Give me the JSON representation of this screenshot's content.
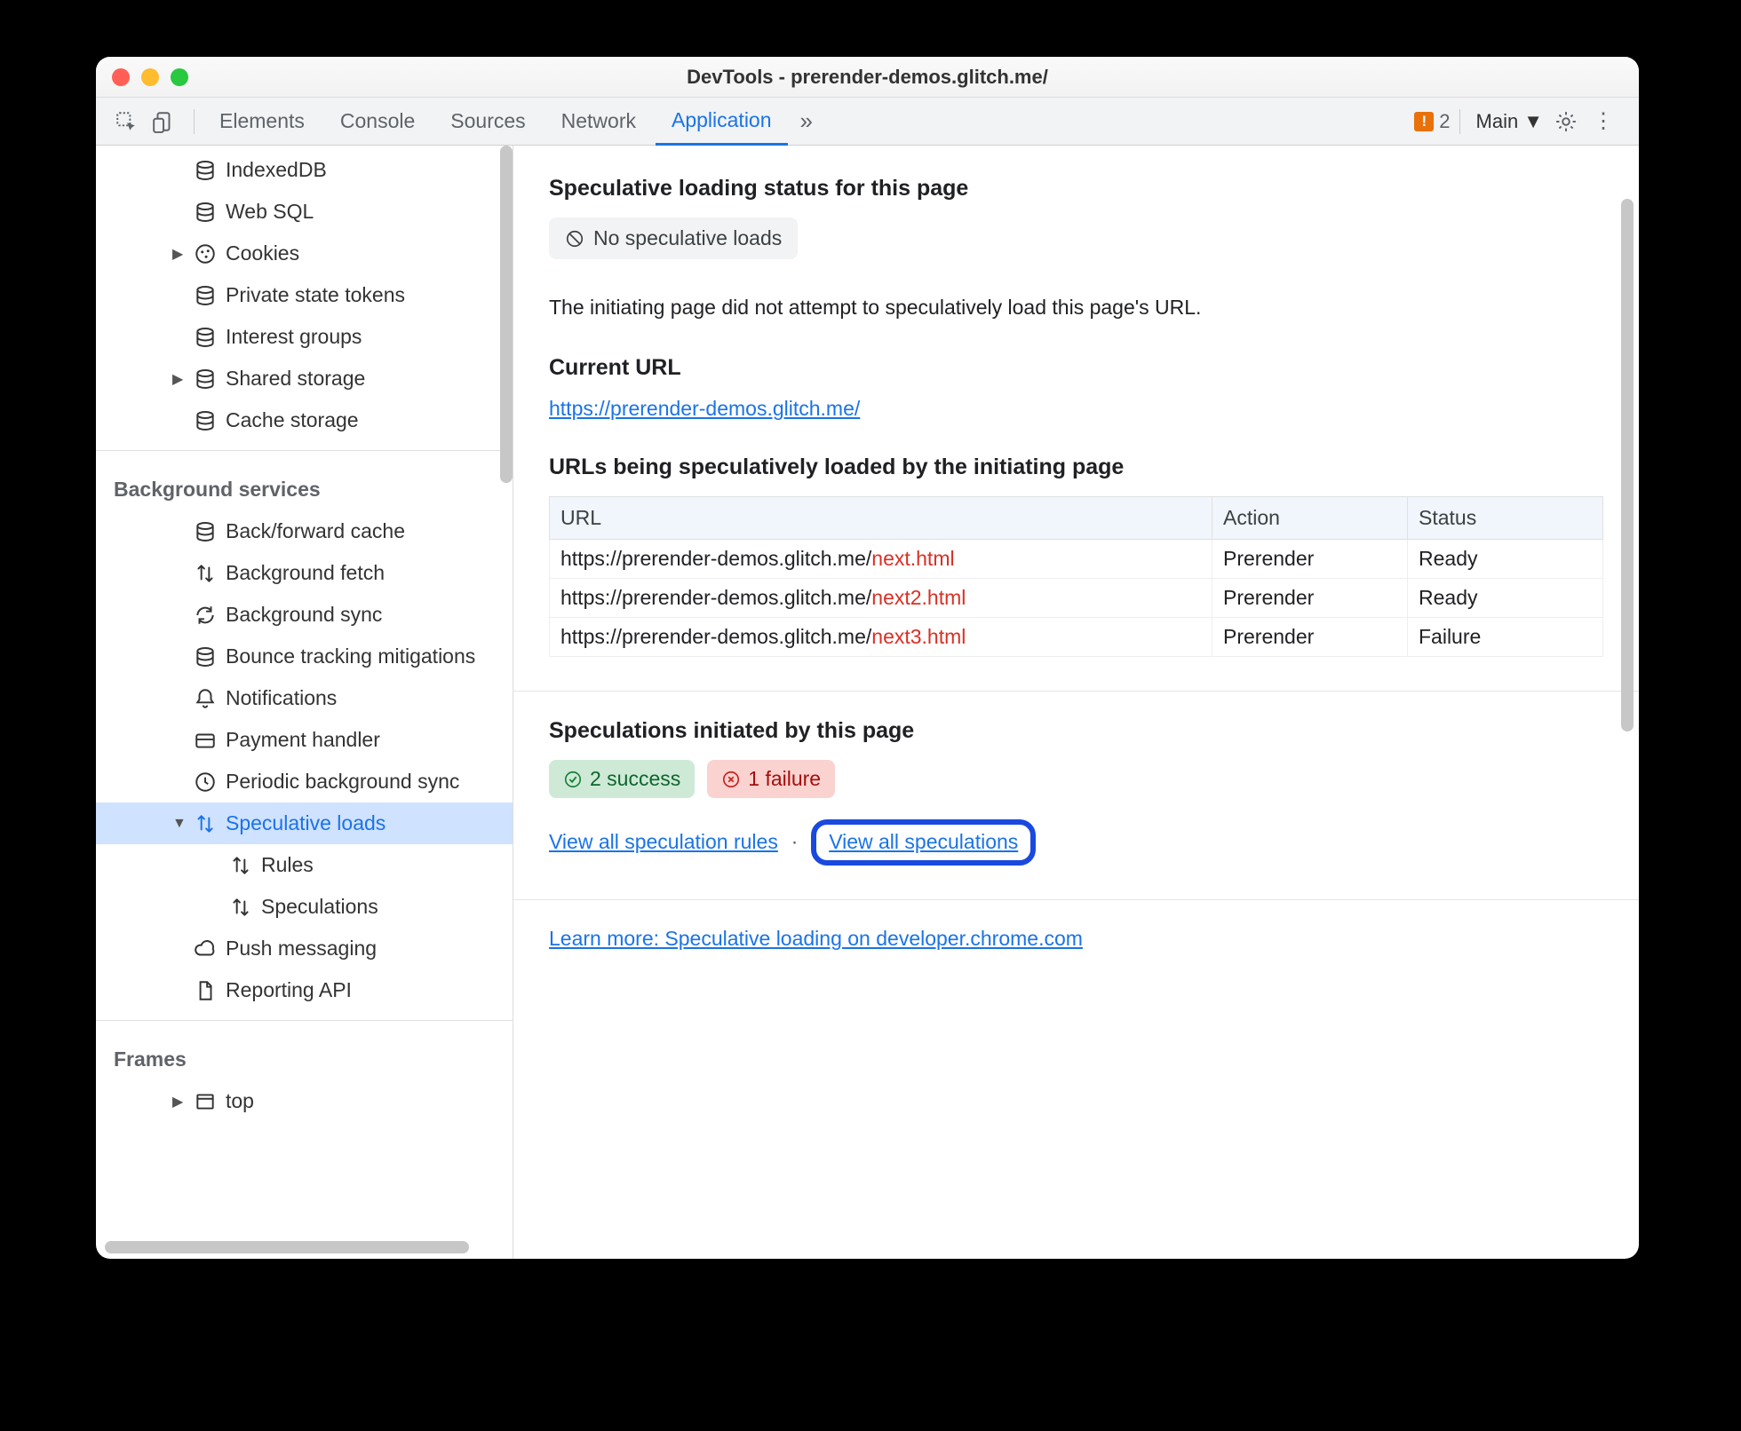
{
  "window": {
    "title": "DevTools - prerender-demos.glitch.me/"
  },
  "toolbar": {
    "tabs": [
      "Elements",
      "Console",
      "Sources",
      "Network",
      "Application"
    ],
    "active_tab": 4,
    "issues_count": "2",
    "main_label": "Main"
  },
  "sidebar": {
    "items_top": [
      {
        "icon": "db",
        "label": "IndexedDB"
      },
      {
        "icon": "db",
        "label": "Web SQL"
      },
      {
        "icon": "cookie",
        "label": "Cookies",
        "caret": true
      },
      {
        "icon": "db",
        "label": "Private state tokens"
      },
      {
        "icon": "db",
        "label": "Interest groups"
      },
      {
        "icon": "db",
        "label": "Shared storage",
        "caret": true
      },
      {
        "icon": "db",
        "label": "Cache storage"
      }
    ],
    "group_bg": "Background services",
    "bg_items": [
      {
        "icon": "db",
        "label": "Back/forward cache"
      },
      {
        "icon": "updown",
        "label": "Background fetch"
      },
      {
        "icon": "sync",
        "label": "Background sync"
      },
      {
        "icon": "db",
        "label": "Bounce tracking mitigations"
      },
      {
        "icon": "bell",
        "label": "Notifications"
      },
      {
        "icon": "card",
        "label": "Payment handler"
      },
      {
        "icon": "clock",
        "label": "Periodic background sync"
      },
      {
        "icon": "updown",
        "label": "Speculative loads",
        "selected": true,
        "caret_down": true
      },
      {
        "icon": "updown",
        "label": "Rules",
        "indent": 2
      },
      {
        "icon": "updown",
        "label": "Speculations",
        "indent": 2
      },
      {
        "icon": "cloud",
        "label": "Push messaging"
      },
      {
        "icon": "file",
        "label": "Reporting API"
      }
    ],
    "group_frames": "Frames",
    "frames_items": [
      {
        "icon": "frame",
        "label": "top",
        "caret": true
      }
    ]
  },
  "content": {
    "h_status": "Speculative loading status for this page",
    "no_loads": "No speculative loads",
    "note": "The initiating page did not attempt to speculatively load this page's URL.",
    "h_current": "Current URL",
    "current_url": "https://prerender-demos.glitch.me/",
    "h_urls": "URLs being speculatively loaded by the initiating page",
    "table": {
      "headers": [
        "URL",
        "Action",
        "Status"
      ],
      "rows": [
        {
          "base": "https://prerender-demos.glitch.me/",
          "path": "next.html",
          "action": "Prerender",
          "status": "Ready"
        },
        {
          "base": "https://prerender-demos.glitch.me/",
          "path": "next2.html",
          "action": "Prerender",
          "status": "Ready"
        },
        {
          "base": "https://prerender-demos.glitch.me/",
          "path": "next3.html",
          "action": "Prerender",
          "status": "Failure"
        }
      ]
    },
    "h_speculations": "Speculations initiated by this page",
    "success_chip": "2 success",
    "failure_chip": "1 failure",
    "link_rules": "View all speculation rules",
    "link_specs": "View all speculations",
    "learn_more": "Learn more: Speculative loading on developer.chrome.com"
  }
}
